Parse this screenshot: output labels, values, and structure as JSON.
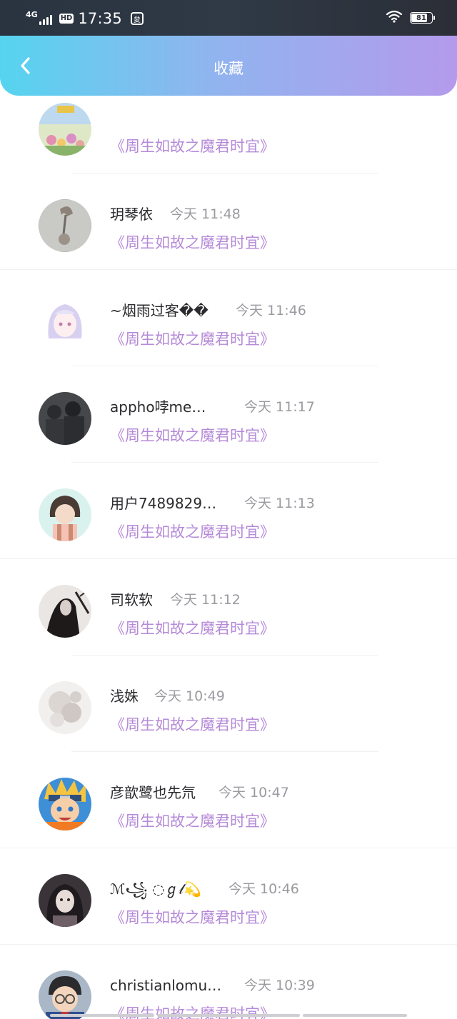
{
  "status_bar": {
    "network": "4G",
    "hd": "HD",
    "time": "17:35",
    "app_badge": "夋",
    "battery": "81"
  },
  "header": {
    "title": "收藏",
    "back_icon": "chevron-left-icon"
  },
  "items": [
    {
      "username": "",
      "time": "",
      "novel": "《周生如故之魔君时宜》",
      "avatar": "avatar-flowers"
    },
    {
      "username": "玥琴依",
      "time": "今天 11:48",
      "novel": "《周生如故之魔君时宜》",
      "avatar": "avatar-grey-sketch"
    },
    {
      "username": "~烟雨过客��",
      "time": "今天 11:46",
      "novel": "《周生如故之魔君时宜》",
      "avatar": "avatar-anime-girl-white"
    },
    {
      "username": "appho哱me…",
      "time": "今天 11:17",
      "novel": "《周生如故之魔君时宜》",
      "avatar": "avatar-soldiers"
    },
    {
      "username": "用户7489829…",
      "time": "今天 11:13",
      "novel": "《周生如故之魔君时宜》",
      "avatar": "avatar-cartoon-girl"
    },
    {
      "username": "司软软",
      "time": "今天 11:12",
      "novel": "《周生如故之魔君时宜》",
      "avatar": "avatar-dark-figure"
    },
    {
      "username": "浅姝",
      "time": "今天 10:49",
      "novel": "《周生如故之魔君时宜》",
      "avatar": "avatar-pale-flowers"
    },
    {
      "username": "彦歆鹭也先氘",
      "time": "今天 10:47",
      "novel": "《周生如故之魔君时宜》",
      "avatar": "avatar-naruto"
    },
    {
      "username": "ℳ꧁ ◌ℊ𝓁💫",
      "time": "今天 10:46",
      "novel": "《周生如故之魔君时宜》",
      "avatar": "avatar-goth-girl"
    },
    {
      "username": "christianlomu…",
      "time": "今天 10:39",
      "novel": "《周生如故之魔君时宜》",
      "avatar": "avatar-conan"
    }
  ],
  "colors": {
    "status_bar_bg": "#2d3540",
    "header_gradient_start": "#56d4ef",
    "header_gradient_end": "#b49aec",
    "novel_title": "#b58ad8",
    "timestamp": "#9a9aa0",
    "username": "#2a2a2e"
  }
}
